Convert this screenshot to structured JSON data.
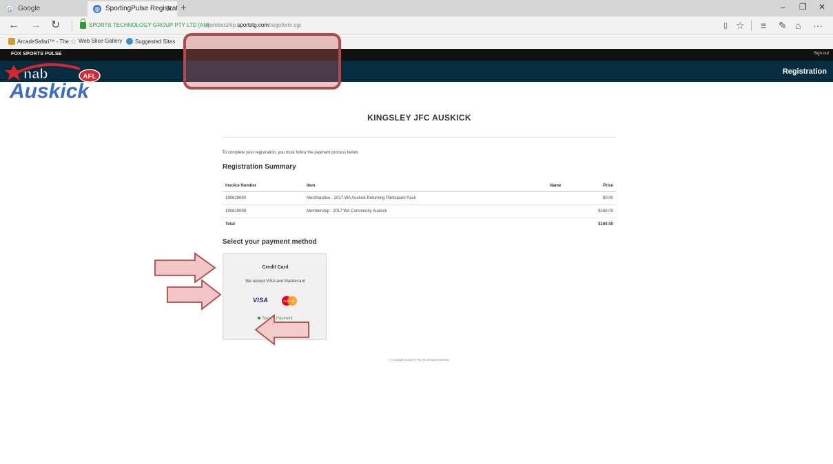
{
  "browser": {
    "tabs": [
      {
        "label": "Google"
      },
      {
        "label": "SportingPulse Registrati"
      }
    ],
    "cert_label": "SPORTS TECHNOLOGY GROUP PTY LTD [AU]",
    "url_prefix": "membership.",
    "url_domain": "sportstg.com",
    "url_path": "/regoform.cgi",
    "favorites": [
      {
        "label": "ArcadeSafari™ - The"
      },
      {
        "label": "Web Slice Gallery"
      },
      {
        "label": "Suggested Sites"
      }
    ]
  },
  "site": {
    "top_bar_label": "FOX SPORTS PULSE",
    "sign_out": "Sign out",
    "header_title": "Registration",
    "logo_nab": "nab",
    "logo_afl": "AFL",
    "logo_auskick": "Auskick"
  },
  "main": {
    "club_title": "KINGSLEY JFC AUSKICK",
    "intro": "To complete your registration, you must follow the payment process below.",
    "summary_heading": "Registration Summary",
    "table": {
      "headers": [
        "Invoice Number",
        "Item",
        "Name",
        "Price"
      ],
      "rows": [
        {
          "invoice": "190619080",
          "item": "Merchandise - 2017 WA Auskick Returning Participant Pack",
          "name": "",
          "price": "$0.00"
        },
        {
          "invoice": "190619098",
          "item": "Membership - 2017 WA Community Auskick",
          "name": "",
          "price": "$160.00"
        }
      ],
      "total_label": "Total",
      "total_value": "$160.00"
    },
    "payment_heading": "Select your payment method",
    "credit_card": {
      "title": "Credit Card",
      "accept_text": "We accept VISA and Mastercard",
      "visa": "VISA",
      "mastercard": "MasterCard",
      "secure_label": "Secure Payment"
    },
    "copyright": "© Copyright SportsTG Pty Ltd. All rights reserved."
  },
  "colors": {
    "header_bg": "#062d3f",
    "top_bar_bg": "#111111",
    "annotation": "#b04a4a",
    "secure_green": "#3a9a3a"
  }
}
